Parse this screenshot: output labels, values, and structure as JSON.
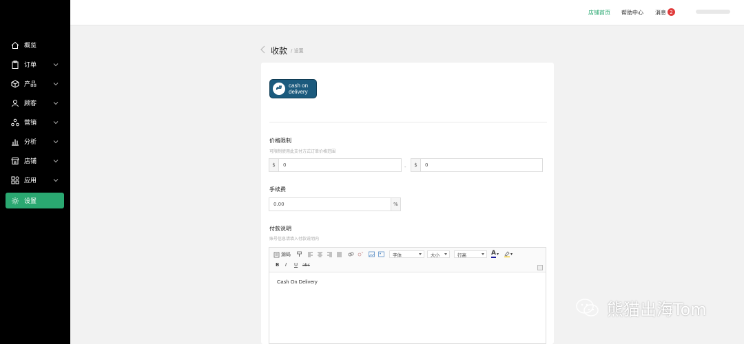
{
  "sidebar": {
    "items": [
      {
        "label": "概览",
        "icon": "home-icon",
        "has_chevron": false
      },
      {
        "label": "订单",
        "icon": "clipboard-icon",
        "has_chevron": true
      },
      {
        "label": "产品",
        "icon": "box-icon",
        "has_chevron": true
      },
      {
        "label": "顾客",
        "icon": "user-icon",
        "has_chevron": true
      },
      {
        "label": "营销",
        "icon": "triangle-icon",
        "has_chevron": true
      },
      {
        "label": "分析",
        "icon": "bar-chart-icon",
        "has_chevron": true
      },
      {
        "label": "店铺",
        "icon": "store-icon",
        "has_chevron": true
      },
      {
        "label": "应用",
        "icon": "apps-icon",
        "has_chevron": true
      },
      {
        "label": "设置",
        "icon": "gear-icon",
        "has_chevron": false,
        "active": true
      }
    ],
    "active_color": "#2aa871"
  },
  "topbar": {
    "store_home": "店铺首页",
    "help": "帮助中心",
    "messages": "消息",
    "messages_count": "2"
  },
  "header": {
    "title": "收款",
    "breadcrumb": "/ 设置"
  },
  "card": {
    "logo_text_line1": "cash on",
    "logo_text_line2": "delivery",
    "price_limit": {
      "title": "价格限制",
      "hint": "可限制使用此支付方式订单价格范围",
      "min_prefix": "$",
      "min_value": "0",
      "separator": "-",
      "max_prefix": "$",
      "max_value": "0"
    },
    "fee": {
      "title": "手续费",
      "value": "0.00",
      "suffix": "%"
    },
    "payment_desc": {
      "title": "付款说明",
      "hint": "账号信息请填入付款说明内",
      "toolbar": {
        "source": "源码",
        "font": "字体",
        "size": "大小",
        "line_height": "行高",
        "bold": "B",
        "italic": "I",
        "underline": "U",
        "strike": "abc"
      },
      "content": "Cash On Delivery"
    }
  },
  "watermark": "熊猫出海Tom"
}
